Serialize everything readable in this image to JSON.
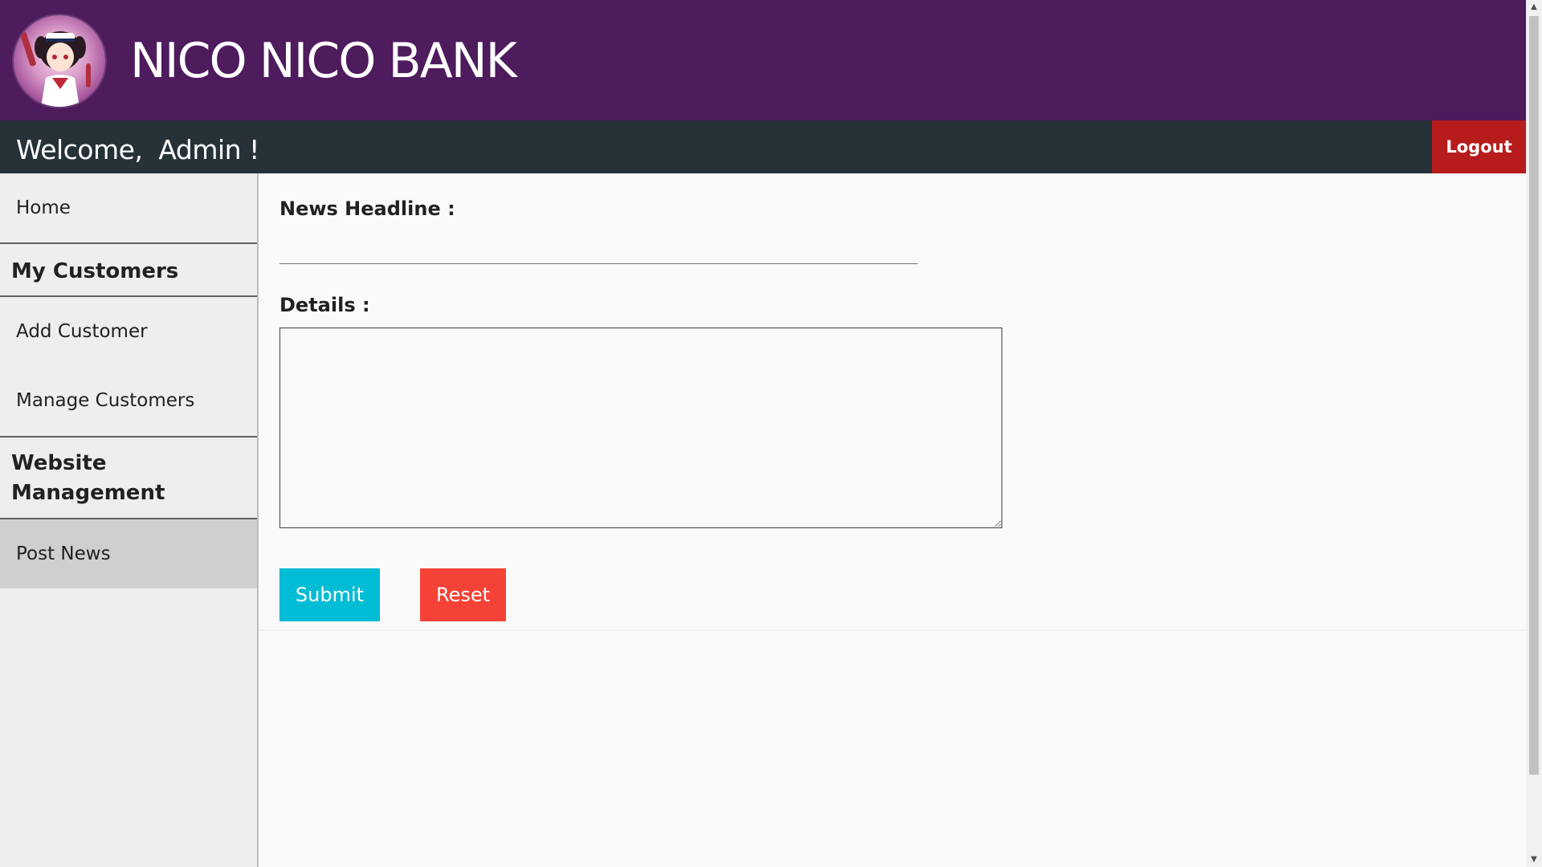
{
  "header": {
    "brand": "NICO NICO BANK"
  },
  "subbar": {
    "welcome": "Welcome,  Admin !",
    "logout_label": "Logout"
  },
  "sidebar": {
    "home": "Home",
    "section_customers": "My Customers",
    "add_customer": "Add Customer",
    "manage_customers": "Manage Customers",
    "section_website_line1": "Website",
    "section_website_line2": "Management",
    "post_news": "Post News",
    "active_item": "Post News"
  },
  "form": {
    "headline_label": "News Headline :",
    "headline_value": "",
    "details_label": "Details :",
    "details_value": "",
    "submit_label": "Submit",
    "reset_label": "Reset"
  },
  "colors": {
    "header_bg": "#4e1b5d",
    "subbar_bg": "#263238",
    "logout_bg": "#b71c1c",
    "submit_bg": "#00bcd4",
    "reset_bg": "#f44336",
    "sidebar_bg": "#eeeeee",
    "sidebar_active_bg": "#cfcfcf"
  },
  "icons": {
    "logo": "avatar-logo",
    "scroll_up": "scroll-up-arrow-icon",
    "scroll_down": "scroll-down-arrow-icon"
  }
}
